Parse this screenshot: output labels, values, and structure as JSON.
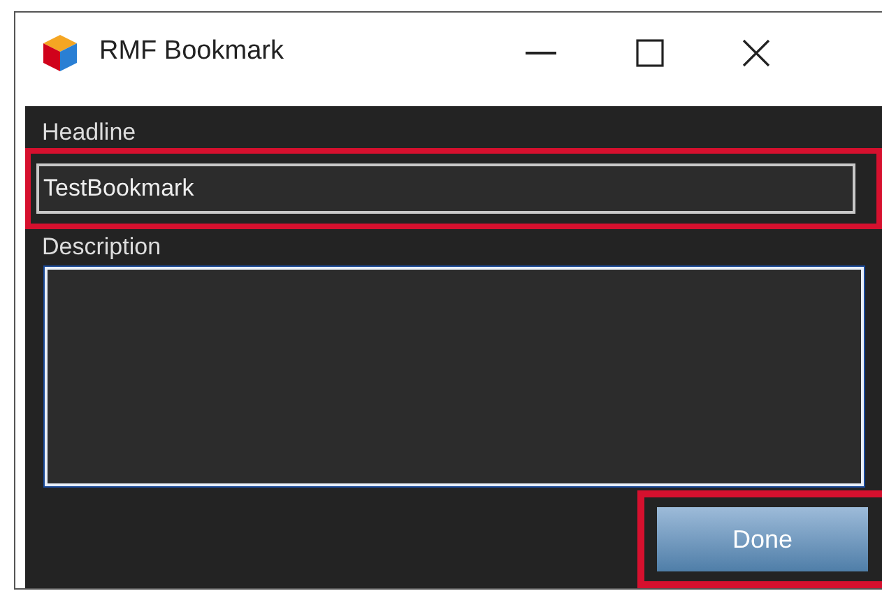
{
  "window": {
    "title": "RMF Bookmark"
  },
  "headline": {
    "label": "Headline",
    "value": "TestBookmark",
    "highlighted": true
  },
  "description": {
    "label": "Description",
    "focused": true
  },
  "done_button": {
    "label": "Done",
    "highlighted": true
  }
}
